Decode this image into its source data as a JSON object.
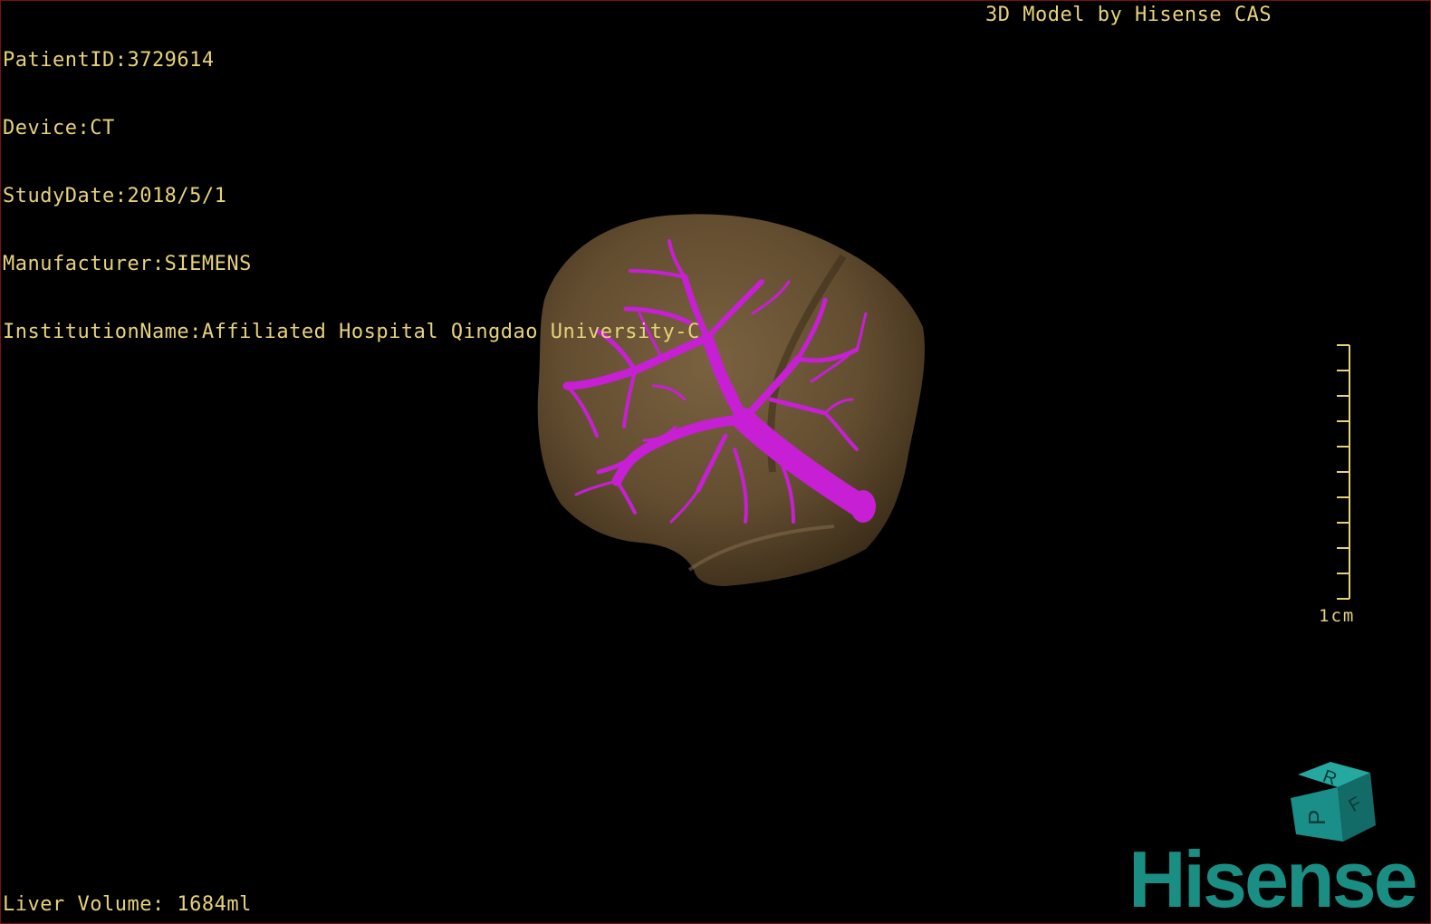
{
  "study_info": {
    "patient_id": "PatientID:3729614",
    "device": "Device:CT",
    "study_date": "StudyDate:2018/5/1",
    "manufacturer": "Manufacturer:SIEMENS",
    "institution": "InstitutionName:Affiliated Hospital Qingdao University-C"
  },
  "model_credit": "3D Model by Hisense CAS",
  "liver_volume": "Liver Volume: 1684ml",
  "scale_bar": {
    "label": "1cm",
    "ticks": 11
  },
  "orientation_cube": {
    "top_letter": "R",
    "front_letter": "P",
    "side_letter": "F"
  },
  "logo_text": "Hisense",
  "colors": {
    "overlay_text": "#e7d27a",
    "liver": "#6b5535",
    "vessels": "#c61fd4",
    "cube": "#1a8f8a",
    "logo": "#1b8e84"
  }
}
